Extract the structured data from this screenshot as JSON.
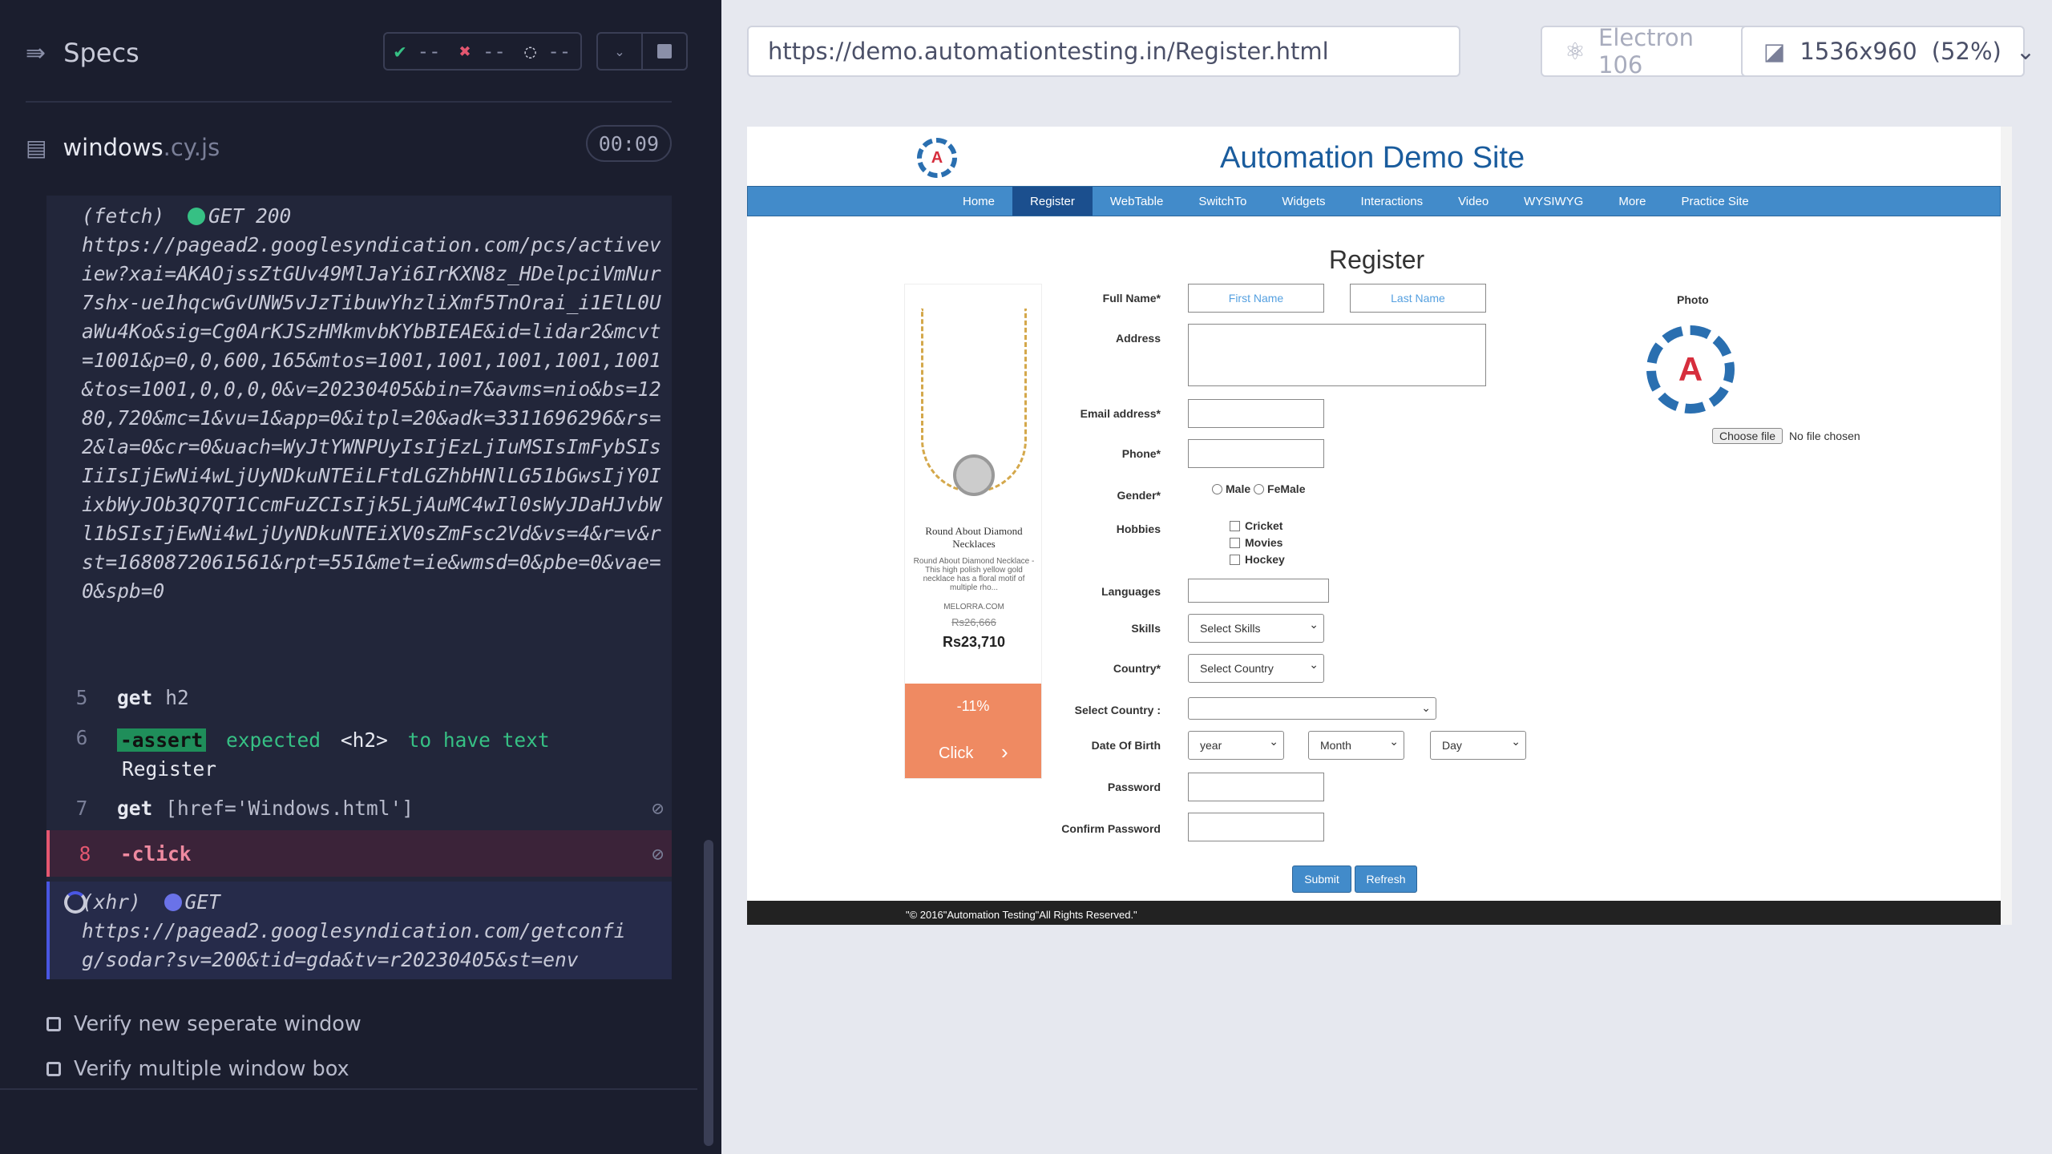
{
  "reporter": {
    "specs_label": "Specs",
    "stats": {
      "passed": "--",
      "failed": "--",
      "pending": "--"
    },
    "file": {
      "name": "windows",
      "ext": ".cy.js",
      "timer": "00:09"
    },
    "fetch_log": {
      "kind": "(fetch)",
      "method": "GET 200",
      "url": "https://pagead2.googlesyndication.com/pcs/activeview?xai=AKAOjssZtGUv49MlJaYi6IrKXN8z_HDelpciVmNur7shx-ue1hqcwGvUNW5vJzTibuwYhzliXmf5TnOrai_i1ElL0UaWu4Ko&sig=Cg0ArKJSzHMkmvbKYbBIEAE&id=lidar2&mcvt=1001&p=0,0,600,165&mtos=1001,1001,1001,1001,1001&tos=1001,0,0,0,0&v=20230405&bin=7&avms=nio&bs=1280,720&mc=1&vu=1&app=0&itpl=20&adk=3311696296&rs=2&la=0&cr=0&uach=WyJtYWNPUyIsIjEzLjIuMSIsImFybSIsIiIsIjEwNi4wLjUyNDkuNTEiLFtdLGZhbHNlLG51bGwsIjY0IixbWyJOb3Q7QT1CcmFuZCIsIjk5LjAuMC4wIl0sWyJDaHJvbWl1bSIsIjEwNi4wLjUyNDkuNTEiXV0sZmFsc2Vd&vs=4&r=v&rst=1680872061561&rpt=551&met=ie&wmsd=0&pbe=0&vae=0&spb=0"
    },
    "commands": [
      {
        "num": "5",
        "name": "get",
        "arg": "h2"
      },
      {
        "num": "6",
        "name": "-assert",
        "text1": "expected",
        "tag": "<h2>",
        "text2": "to have text",
        "value": "Register"
      },
      {
        "num": "7",
        "name": "get",
        "arg": "[href='Windows.html']"
      },
      {
        "num": "8",
        "name": "-click"
      }
    ],
    "xhr_log": {
      "kind": "(xhr)",
      "method": "GET",
      "url": "https://pagead2.googlesyndication.com/getconfig/sodar?sv=200&tid=gda&tv=r20230405&st=env"
    },
    "tests": [
      "Verify new seperate window",
      "Verify multiple window box"
    ]
  },
  "toolbar": {
    "url": "https://demo.automationtesting.in/Register.html",
    "browser": "Electron 106",
    "viewport": "1536x960",
    "scale": "(52%)"
  },
  "site": {
    "title": "Automation Demo Site",
    "nav": [
      "Home",
      "Register",
      "WebTable",
      "SwitchTo",
      "Widgets",
      "Interactions",
      "Video",
      "WYSIWYG",
      "More",
      "Practice Site"
    ],
    "heading": "Register",
    "labels": {
      "full_name": "Full Name*",
      "address": "Address",
      "email": "Email address*",
      "phone": "Phone*",
      "gender": "Gender*",
      "hobbies": "Hobbies",
      "languages": "Languages",
      "skills": "Skills",
      "country": "Country*",
      "select_country": "Select Country :",
      "dob": "Date Of Birth",
      "password": "Password",
      "confirm": "Confirm Password"
    },
    "placeholders": {
      "first": "First Name",
      "last": "Last Name"
    },
    "gender_opts": [
      "Male",
      "FeMale"
    ],
    "hobbies": [
      "Cricket",
      "Movies",
      "Hockey"
    ],
    "skills_sel": "Select Skills",
    "country_sel": "Select Country",
    "dob": {
      "year": "year",
      "month": "Month",
      "day": "Day"
    },
    "buttons": {
      "submit": "Submit",
      "refresh": "Refresh"
    },
    "photo": {
      "label": "Photo",
      "choose": "Choose file",
      "status": "No file chosen"
    },
    "ad": {
      "title": "Round About Diamond Necklaces",
      "desc": "Round About Diamond Necklace - This high polish yellow gold necklace has a floral motif of multiple rho...",
      "brand": "MELORRA.COM",
      "old_price": "Rs26,666",
      "price": "Rs23,710",
      "discount": "-11%",
      "cta": "Click"
    },
    "footer": "\"© 2016\"Automation Testing\"All Rights Reserved.\""
  }
}
